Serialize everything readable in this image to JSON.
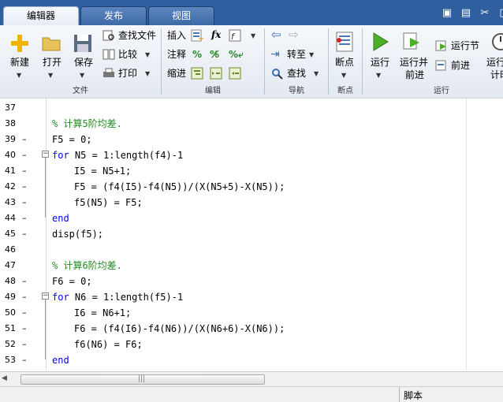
{
  "tabs": [
    {
      "label": "编辑器",
      "active": true
    },
    {
      "label": "发布",
      "active": false
    },
    {
      "label": "视图",
      "active": false
    }
  ],
  "ribbon": {
    "file": {
      "new_label": "新建",
      "open_label": "打开",
      "save_label": "保存",
      "find_file_label": "查找文件",
      "compare_label": "比较",
      "print_label": "打印",
      "group_label": "文件"
    },
    "edit": {
      "insert_label": "插入",
      "comment_label": "注释",
      "indent_label": "缩进",
      "fx_label": "fx",
      "group_label": "编辑"
    },
    "navigate": {
      "goto_label": "转至",
      "find_label": "查找",
      "group_label": "导航"
    },
    "breakpoints": {
      "breakpoints_label": "断点",
      "group_label": "断点"
    },
    "run": {
      "run_label": "运行",
      "run_advance_label_1": "运行并",
      "run_advance_label_2": "前进",
      "run_section_label": "运行节",
      "advance_label": "前进",
      "run_time_label_1": "运行",
      "run_time_label_2": "计时",
      "group_label": "运行"
    }
  },
  "editor": {
    "lines": [
      {
        "num": "37",
        "dash": "",
        "indent": 0,
        "parts": [
          {
            "t": "",
            "c": "n"
          }
        ]
      },
      {
        "num": "38",
        "dash": "",
        "indent": 0,
        "parts": [
          {
            "t": "% 计算5阶均差.",
            "c": "cm"
          }
        ]
      },
      {
        "num": "39",
        "dash": "–",
        "indent": 0,
        "parts": [
          {
            "t": "F5 = 0;",
            "c": "n"
          }
        ]
      },
      {
        "num": "40",
        "dash": "–",
        "indent": 0,
        "parts": [
          {
            "t": "for",
            "c": "kw"
          },
          {
            "t": " N5 = 1:length(f4)-1",
            "c": "n"
          }
        ]
      },
      {
        "num": "41",
        "dash": "–",
        "indent": 1,
        "parts": [
          {
            "t": "I5 = N5+1;",
            "c": "n"
          }
        ]
      },
      {
        "num": "42",
        "dash": "–",
        "indent": 1,
        "parts": [
          {
            "t": "F5 = (f4(I5)-f4(N5))/(X(N5+5)-X(N5));",
            "c": "n"
          }
        ]
      },
      {
        "num": "43",
        "dash": "–",
        "indent": 1,
        "parts": [
          {
            "t": "f5(N5) = F5;",
            "c": "n"
          }
        ]
      },
      {
        "num": "44",
        "dash": "–",
        "indent": 0,
        "parts": [
          {
            "t": "end",
            "c": "kw"
          }
        ]
      },
      {
        "num": "45",
        "dash": "–",
        "indent": 0,
        "parts": [
          {
            "t": "disp(f5);",
            "c": "n"
          }
        ]
      },
      {
        "num": "46",
        "dash": "",
        "indent": 0,
        "parts": [
          {
            "t": "",
            "c": "n"
          }
        ]
      },
      {
        "num": "47",
        "dash": "",
        "indent": 0,
        "parts": [
          {
            "t": "% 计算6阶均差.",
            "c": "cm"
          }
        ]
      },
      {
        "num": "48",
        "dash": "–",
        "indent": 0,
        "parts": [
          {
            "t": "F6 = 0;",
            "c": "n"
          }
        ]
      },
      {
        "num": "49",
        "dash": "–",
        "indent": 0,
        "parts": [
          {
            "t": "for",
            "c": "kw"
          },
          {
            "t": " N6 = 1:length(f5)-1",
            "c": "n"
          }
        ]
      },
      {
        "num": "50",
        "dash": "–",
        "indent": 1,
        "parts": [
          {
            "t": "I6 = N6+1;",
            "c": "n"
          }
        ]
      },
      {
        "num": "51",
        "dash": "–",
        "indent": 1,
        "parts": [
          {
            "t": "F6 = (f4(I6)-f4(N6))/(X(N6+6)-X(N6));",
            "c": "n"
          }
        ]
      },
      {
        "num": "52",
        "dash": "–",
        "indent": 1,
        "parts": [
          {
            "t": "f6(N6) = F6;",
            "c": "n"
          }
        ]
      },
      {
        "num": "53",
        "dash": "–",
        "indent": 0,
        "parts": [
          {
            "t": "end",
            "c": "kw"
          }
        ]
      }
    ]
  },
  "statusbar": {
    "mode_label": "脚本"
  },
  "colors": {
    "keyword": "#0000ff",
    "comment": "#228b22",
    "tab_strip": "#2f5f9e"
  }
}
